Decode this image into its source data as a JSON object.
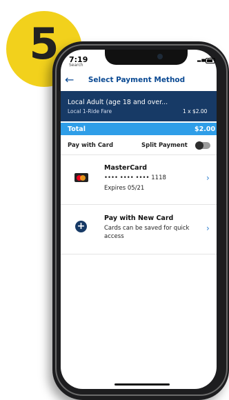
{
  "step": {
    "number": "5",
    "color": "#f2d11c"
  },
  "status_bar": {
    "time": "7:19",
    "back_app": "Search",
    "signal_icon": "signal-icon",
    "wifi_icon": "wifi-icon",
    "battery_icon": "battery-icon"
  },
  "header": {
    "back_icon": "back-arrow-icon",
    "title": "Select Payment Method"
  },
  "fare": {
    "name": "Local Adult (age 18 and over...",
    "type": "Local 1-Ride Fare",
    "quantity_price": "1 x $2.00"
  },
  "total": {
    "label": "Total",
    "amount": "$2.00"
  },
  "payment_options": {
    "pay_with_card_label": "Pay with Card",
    "split_payment_label": "Split Payment",
    "split_payment_enabled": false
  },
  "saved_card": {
    "icon": "mastercard-icon",
    "brand": "MasterCard",
    "masked_number": "•••• •••• •••• 1118",
    "expiry": "Expires 05/21"
  },
  "new_card": {
    "icon": "plus-circle-icon",
    "title": "Pay with New Card",
    "description": "Cards can be saved for quick access"
  },
  "colors": {
    "primary_blue": "#0b4a93",
    "navy": "#173a66",
    "accent_blue": "#2f9ee8"
  }
}
